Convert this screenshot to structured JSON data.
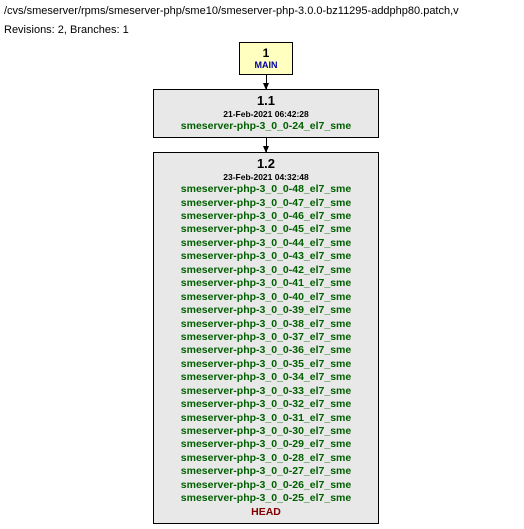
{
  "header": {
    "path": "/cvs/smeserver/rpms/smeserver-php/sme10/smeserver-php-3.0.0-bz11295-addphp80.patch,v",
    "stats": "Revisions: 2, Branches: 1"
  },
  "nodes": {
    "main": {
      "num": "1",
      "label": "MAIN"
    },
    "rev1": {
      "version": "1.1",
      "date": "21-Feb-2021 06:42:28",
      "tags": [
        "smeserver-php-3_0_0-24_el7_sme"
      ]
    },
    "rev2": {
      "version": "1.2",
      "date": "23-Feb-2021 04:32:48",
      "tags": [
        "smeserver-php-3_0_0-48_el7_sme",
        "smeserver-php-3_0_0-47_el7_sme",
        "smeserver-php-3_0_0-46_el7_sme",
        "smeserver-php-3_0_0-45_el7_sme",
        "smeserver-php-3_0_0-44_el7_sme",
        "smeserver-php-3_0_0-43_el7_sme",
        "smeserver-php-3_0_0-42_el7_sme",
        "smeserver-php-3_0_0-41_el7_sme",
        "smeserver-php-3_0_0-40_el7_sme",
        "smeserver-php-3_0_0-39_el7_sme",
        "smeserver-php-3_0_0-38_el7_sme",
        "smeserver-php-3_0_0-37_el7_sme",
        "smeserver-php-3_0_0-36_el7_sme",
        "smeserver-php-3_0_0-35_el7_sme",
        "smeserver-php-3_0_0-34_el7_sme",
        "smeserver-php-3_0_0-33_el7_sme",
        "smeserver-php-3_0_0-32_el7_sme",
        "smeserver-php-3_0_0-31_el7_sme",
        "smeserver-php-3_0_0-30_el7_sme",
        "smeserver-php-3_0_0-29_el7_sme",
        "smeserver-php-3_0_0-28_el7_sme",
        "smeserver-php-3_0_0-27_el7_sme",
        "smeserver-php-3_0_0-26_el7_sme",
        "smeserver-php-3_0_0-25_el7_sme"
      ],
      "head": "HEAD"
    }
  }
}
